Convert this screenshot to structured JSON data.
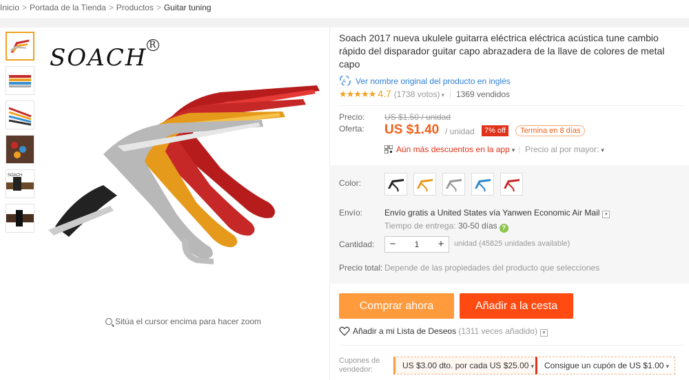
{
  "breadcrumb": {
    "items": [
      "Inicio",
      "Portada de la Tienda",
      "Productos",
      "Guitar tuning"
    ],
    "separator": ">"
  },
  "gallery": {
    "brand_logo": "SOACH",
    "zoom_hint": "Sitúa el cursor encima para hacer zoom",
    "thumbnail_count": 6
  },
  "product": {
    "title": "Soach 2017 nueva ukulele guitarra eléctrica eléctrica acústica tune cambio rápido del disparador guitar capo abrazadera de la llave de colores de metal capo",
    "original_name_link": "Ver nombre original del producto en inglés",
    "rating": {
      "stars": "★★★★★",
      "value": "4.7",
      "votes": "(1738 votos)"
    },
    "sold": "1369 vendidos"
  },
  "price": {
    "label_price": "Precio:",
    "old_price": "US $1.50 / unidad",
    "label_offer": "Oferta:",
    "offer_price": "US $1.40",
    "unit": "/ unidad",
    "discount_badge": "7% off",
    "ends_badge": "Termina en 8 días",
    "app_discount": "Aún más descuentos en la app",
    "wholesale": "Precio al por mayor:"
  },
  "options": {
    "color_label": "Color:",
    "colors": [
      "black",
      "gold",
      "silver",
      "blue",
      "red"
    ],
    "shipping_label": "Envío:",
    "shipping_prefix": "Envío gratis",
    "shipping_rest": "a United States vía Yanwen Economic Air Mail",
    "delivery_label": "Tiempo de entrega:",
    "delivery_value": "30-50 días",
    "quantity_label": "Cantidad:",
    "quantity_value": "1",
    "quantity_minus": "−",
    "quantity_plus": "+",
    "quantity_available": "unidad (45825 unidades available)",
    "total_label": "Precio total:",
    "total_note": "Depende de las propiedades del producto que selecciones"
  },
  "actions": {
    "buy_now": "Comprar ahora",
    "add_to_cart": "Añadir a la cesta",
    "wishlist": "Añadir a mi Lista de Deseos",
    "wishlist_count": "(1311 veces añadido)"
  },
  "coupons": {
    "label": "Cupones de vendedor:",
    "coupon1": "US $3.00 dto. por cada US $25.00",
    "coupon2": "Consigue un cupón de US $1.00"
  },
  "colors": {
    "accent_orange": "#ff9a3d",
    "accent_red": "#ff4b12",
    "price": "#f35f1a",
    "link": "#2e7fd8"
  }
}
